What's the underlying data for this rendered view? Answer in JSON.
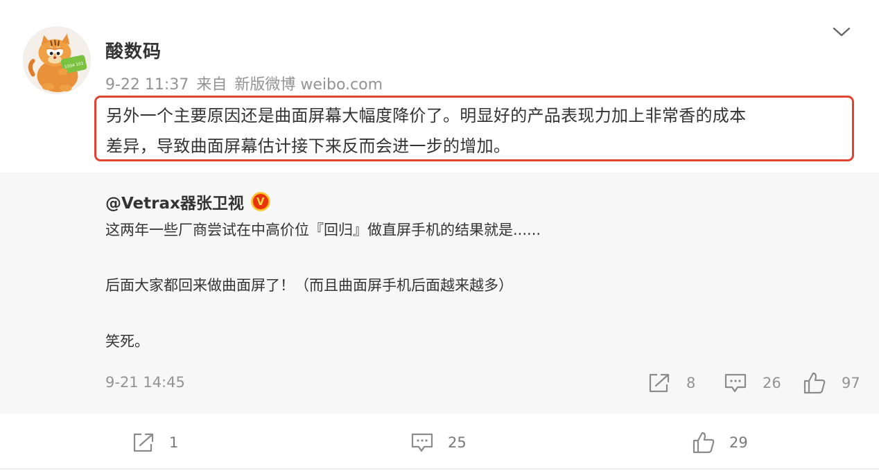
{
  "post": {
    "author": "酸数码",
    "time": "9-22 11:37",
    "source_prefix": "来自",
    "source": "新版微博 weibo.com",
    "text_line1": "另外一个主要原因还是曲面屏幕大幅度降价了。明显好的产品表现力加上非常香的成本",
    "text_line2": "差异，导致曲面屏幕估计接下来反而会进一步的增加。",
    "avatar_label": "1004 101"
  },
  "quote": {
    "author": "@Vetrax器张卫视",
    "badge_letter": "V",
    "line1": "这两年一些厂商尝试在中高价位『回归』做直屏手机的结果就是......",
    "line2": "后面大家都回来做曲面屏了！（而且曲面屏手机后面越来越多）",
    "line3": "笑死。",
    "time": "9-21 14:45",
    "reposts": "8",
    "comments": "26",
    "likes": "97"
  },
  "toolbar": {
    "reposts": "1",
    "comments": "25",
    "likes": "29"
  },
  "colors": {
    "highlight_border": "#e0432f",
    "quote_background": "#f7f7f7",
    "meta_text": "#939393",
    "badge_outer": "#f7b500",
    "badge_inner": "#e8320d"
  }
}
